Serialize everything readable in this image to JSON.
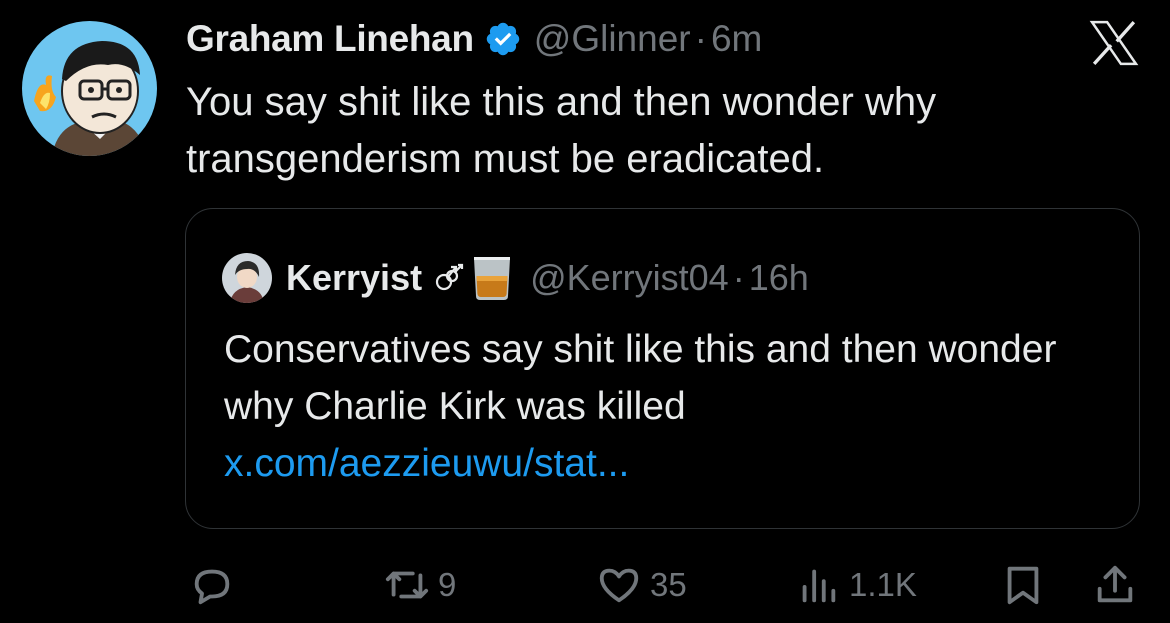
{
  "tweet": {
    "author_name": "Graham Linehan",
    "author_handle": "@Glinner",
    "separator": "·",
    "time": "6m",
    "text": "You say shit like this and then wonder why transgenderism must be eradicated."
  },
  "quote": {
    "author_name": "Kerryist",
    "author_handle": "@Kerryist04",
    "separator": "·",
    "time": "16h",
    "text": "Conservatives say shit like this and then wonder why Charlie Kirk was killed ",
    "link": "x.com/aezzieuwu/stat..."
  },
  "actions": {
    "reply_count": "",
    "retweet_count": "9",
    "like_count": "35",
    "views_count": "1.1K"
  },
  "icons": {
    "verified": "verified-badge-icon",
    "platform": "x-logo-icon",
    "reply": "reply-icon",
    "retweet": "retweet-icon",
    "like": "heart-icon",
    "views": "views-icon",
    "bookmark": "bookmark-icon",
    "share": "share-icon",
    "quote_emoji_1": "male-symbols-emoji",
    "quote_emoji_2": "whiskey-glass-emoji"
  },
  "colors": {
    "background": "#000000",
    "text": "#e7e9ea",
    "muted": "#71767b",
    "link": "#1d9bf0",
    "verified": "#1d9bf0",
    "border": "#2f3336"
  }
}
